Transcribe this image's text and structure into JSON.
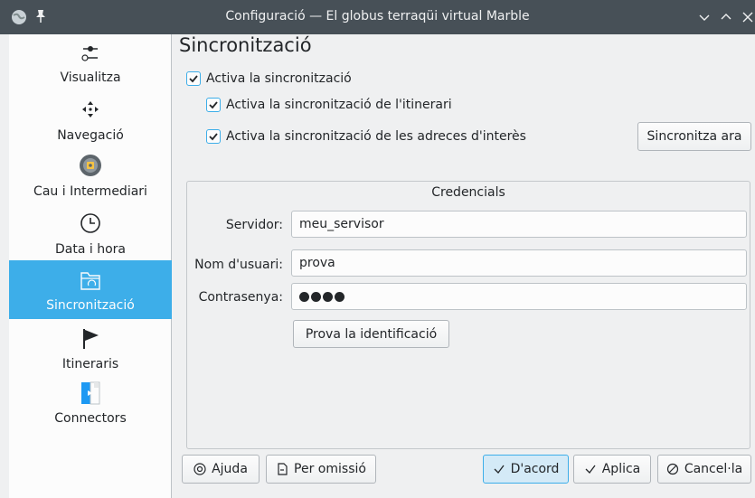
{
  "window": {
    "title": "Configuració — El globus terraqüi virtual Marble"
  },
  "sidebar": {
    "items": [
      {
        "label": "Visualitza",
        "icon": "slider-icon"
      },
      {
        "label": "Navegació",
        "icon": "move-arrows-icon"
      },
      {
        "label": "Cau i Intermediari",
        "icon": "disk-cache-icon"
      },
      {
        "label": "Data i hora",
        "icon": "clock-icon"
      },
      {
        "label": "Sincronització",
        "icon": "folder-sync-icon",
        "active": true
      },
      {
        "label": "Itineraris",
        "icon": "flag-icon"
      },
      {
        "label": "Connectors",
        "icon": "plugin-icon"
      }
    ]
  },
  "main": {
    "title": "Sincronització",
    "enable_sync": {
      "label": "Activa la sincronització",
      "checked": true
    },
    "sync_routes": {
      "label": "Activa la sincronització de l'itinerari",
      "checked": true
    },
    "sync_bookmarks": {
      "label": "Activa la sincronització de les adreces d'interès",
      "checked": true
    },
    "sync_now_label": "Sincronitza ara",
    "credentials": {
      "title": "Credencials",
      "server_label": "Servidor:",
      "server_value": "meu_servisor",
      "user_label": "Nom d'usuari:",
      "user_value": "prova",
      "password_label": "Contrasenya:",
      "password_length": 4,
      "test_label": "Prova la identificació"
    }
  },
  "footer": {
    "help_label": "Ajuda",
    "defaults_label": "Per omissió",
    "ok_label": "D'acord",
    "apply_label": "Aplica",
    "cancel_label": "Cancel·la"
  },
  "colors": {
    "accent": "#3daee9",
    "titlebar": "#475057",
    "window_bg": "#eff0f1"
  }
}
